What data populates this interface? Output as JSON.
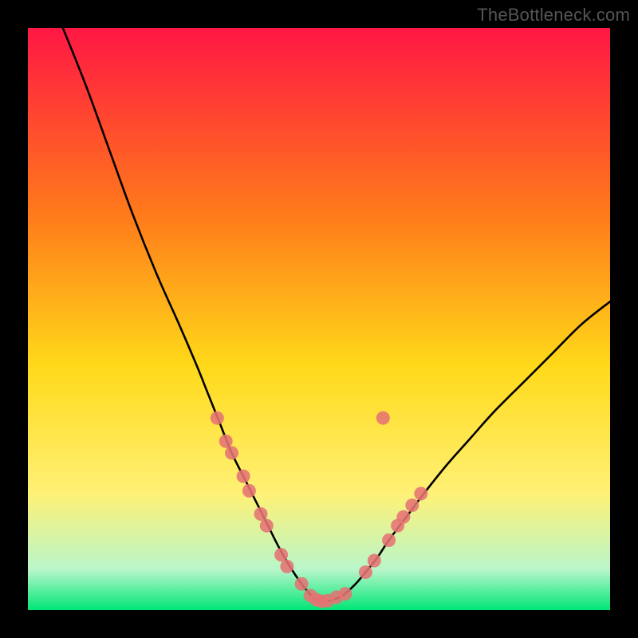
{
  "watermark": "TheBottleneck.com",
  "colors": {
    "black": "#000000",
    "curve": "#000000",
    "marker": "#e57373",
    "gradient_top": "#ff1744",
    "gradient_mid1": "#ff7a1a",
    "gradient_mid2": "#ffd919",
    "gradient_mid3": "#fff176",
    "gradient_green1": "#b9f6ca",
    "gradient_green2": "#00e676"
  },
  "chart_data": {
    "type": "line",
    "title": "",
    "xlabel": "",
    "ylabel": "",
    "xlim": [
      0,
      100
    ],
    "ylim": [
      0,
      100
    ],
    "series": [
      {
        "name": "bottleneck-curve",
        "x": [
          6,
          10,
          14,
          18,
          22,
          26,
          29,
          31,
          33,
          35,
          37,
          39,
          41,
          43,
          45,
          47,
          48.5,
          49.5,
          50.5,
          52,
          54,
          56,
          58,
          60,
          62,
          65,
          68,
          72,
          76,
          80,
          85,
          90,
          95,
          100
        ],
        "y": [
          100,
          90,
          79,
          68,
          58,
          49,
          42,
          37,
          32,
          27,
          23,
          19,
          15,
          11,
          7.5,
          4.5,
          2.7,
          1.8,
          1.5,
          1.6,
          2.5,
          4.2,
          6.5,
          9,
          12,
          16,
          20,
          25,
          29.5,
          34,
          39,
          44,
          49,
          53
        ]
      }
    ],
    "markers": [
      {
        "x": 32.5,
        "y": 33
      },
      {
        "x": 34,
        "y": 29
      },
      {
        "x": 35,
        "y": 27
      },
      {
        "x": 37,
        "y": 23
      },
      {
        "x": 38,
        "y": 20.5
      },
      {
        "x": 40,
        "y": 16.5
      },
      {
        "x": 41,
        "y": 14.5
      },
      {
        "x": 43.5,
        "y": 9.5
      },
      {
        "x": 44.5,
        "y": 7.5
      },
      {
        "x": 47,
        "y": 4.5
      },
      {
        "x": 48.5,
        "y": 2.5
      },
      {
        "x": 49.5,
        "y": 1.8
      },
      {
        "x": 50.5,
        "y": 1.5
      },
      {
        "x": 51.5,
        "y": 1.6
      },
      {
        "x": 53,
        "y": 2.2
      },
      {
        "x": 54.5,
        "y": 2.8
      },
      {
        "x": 58,
        "y": 6.5
      },
      {
        "x": 59.5,
        "y": 8.5
      },
      {
        "x": 62,
        "y": 12
      },
      {
        "x": 63.5,
        "y": 14.5
      },
      {
        "x": 64.5,
        "y": 16
      },
      {
        "x": 66,
        "y": 18
      },
      {
        "x": 67.5,
        "y": 20
      },
      {
        "x": 61,
        "y": 33
      }
    ],
    "grid": false,
    "legend": false
  }
}
